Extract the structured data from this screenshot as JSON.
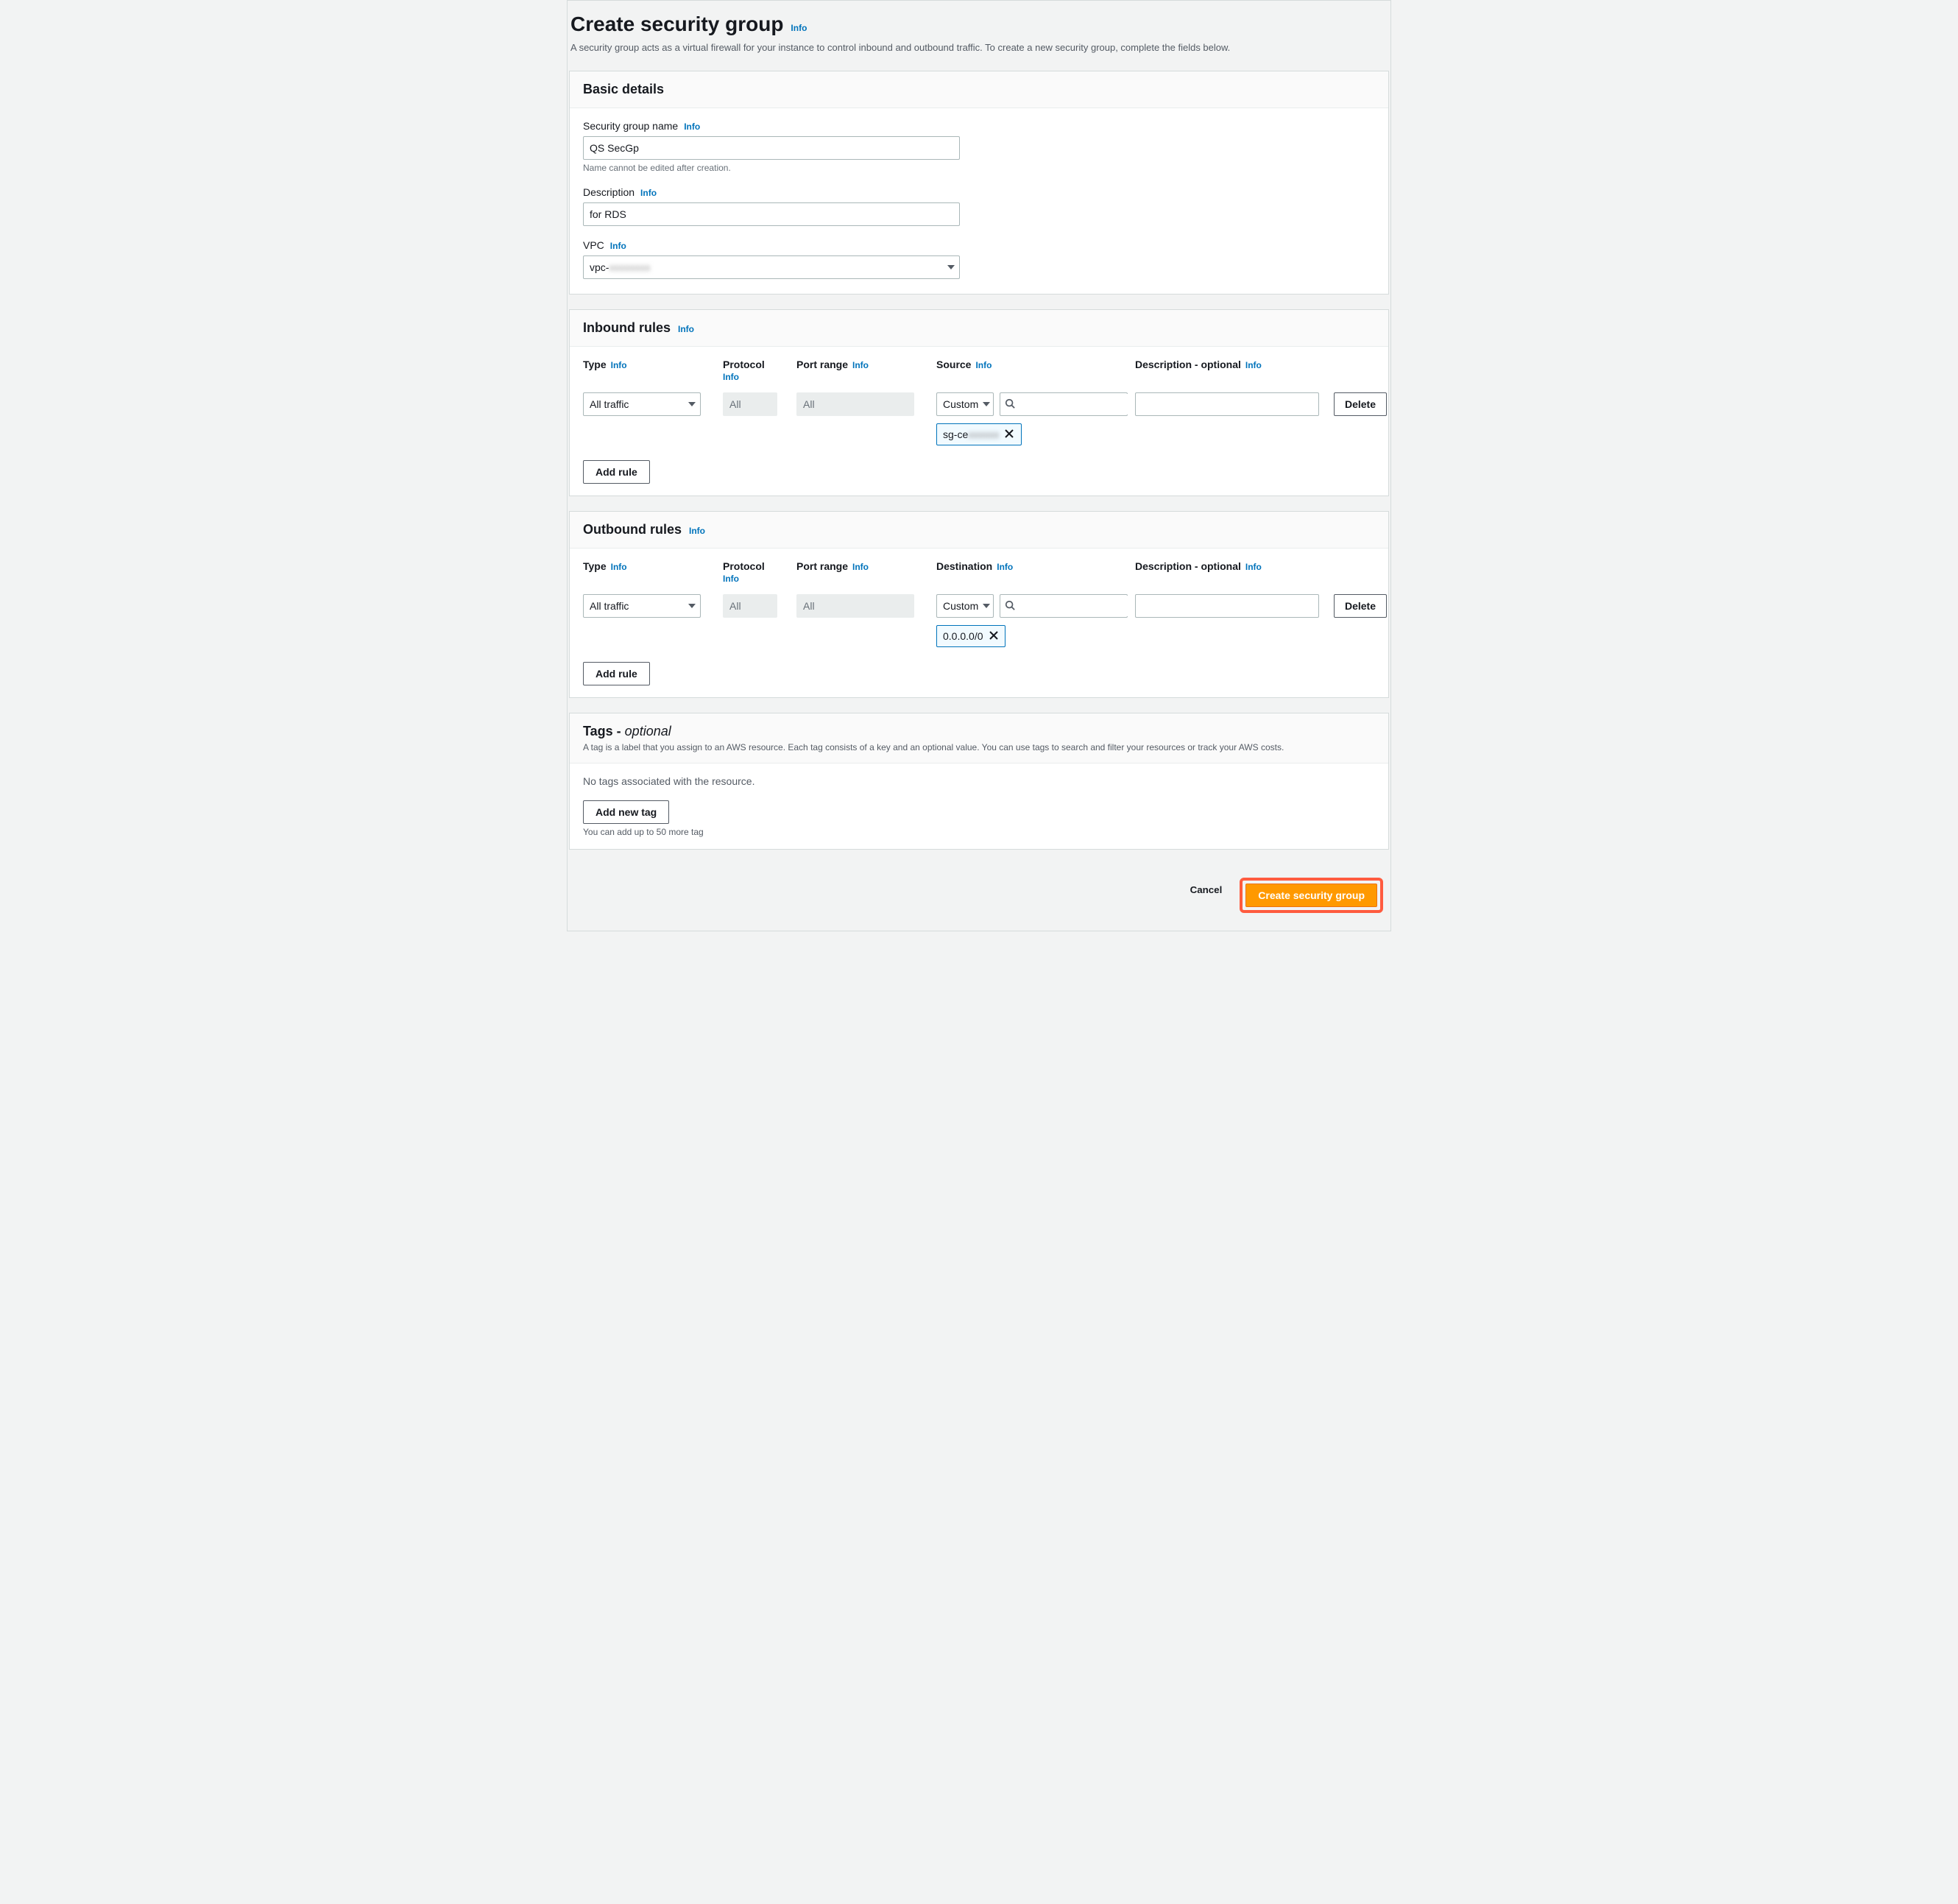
{
  "header": {
    "title": "Create security group",
    "info": "Info",
    "description": "A security group acts as a virtual firewall for your instance to control inbound and outbound traffic. To create a new security group, complete the fields below."
  },
  "basic": {
    "title": "Basic details",
    "name": {
      "label": "Security group name",
      "info": "Info",
      "value": "QS SecGp",
      "constraint": "Name cannot be edited after creation."
    },
    "description": {
      "label": "Description",
      "info": "Info",
      "value": "for RDS"
    },
    "vpc": {
      "label": "VPC",
      "info": "Info",
      "value_visible": "vpc-",
      "value_hidden": "xxxxxxxx"
    }
  },
  "inbound": {
    "title": "Inbound rules",
    "info": "Info",
    "columns": {
      "type": {
        "label": "Type",
        "info": "Info"
      },
      "protocol": {
        "label": "Protocol",
        "info": "Info"
      },
      "port_range": {
        "label": "Port range",
        "info": "Info"
      },
      "source": {
        "label": "Source",
        "info": "Info"
      },
      "description": {
        "label": "Description - optional",
        "info": "Info"
      }
    },
    "row": {
      "type": "All traffic",
      "protocol": "All",
      "port_range": "All",
      "source_mode": "Custom",
      "source_token_visible": "sg-ce",
      "source_token_hidden": "xxxxxx",
      "description": "",
      "delete": "Delete"
    },
    "add_rule": "Add rule"
  },
  "outbound": {
    "title": "Outbound rules",
    "info": "Info",
    "columns": {
      "type": {
        "label": "Type",
        "info": "Info"
      },
      "protocol": {
        "label": "Protocol",
        "info": "Info"
      },
      "port_range": {
        "label": "Port range",
        "info": "Info"
      },
      "destination": {
        "label": "Destination",
        "info": "Info"
      },
      "description": {
        "label": "Description - optional",
        "info": "Info"
      }
    },
    "row": {
      "type": "All traffic",
      "protocol": "All",
      "port_range": "All",
      "dest_mode": "Custom",
      "dest_token": "0.0.0.0/0",
      "description": "",
      "delete": "Delete"
    },
    "add_rule": "Add rule"
  },
  "tags": {
    "title_prefix": "Tags - ",
    "title_suffix": "optional",
    "description": "A tag is a label that you assign to an AWS resource. Each tag consists of a key and an optional value. You can use tags to search and filter your resources or track your AWS costs.",
    "empty": "No tags associated with the resource.",
    "add_new": "Add new tag",
    "limit": "You can add up to 50 more tag"
  },
  "footer": {
    "cancel": "Cancel",
    "create": "Create security group"
  }
}
